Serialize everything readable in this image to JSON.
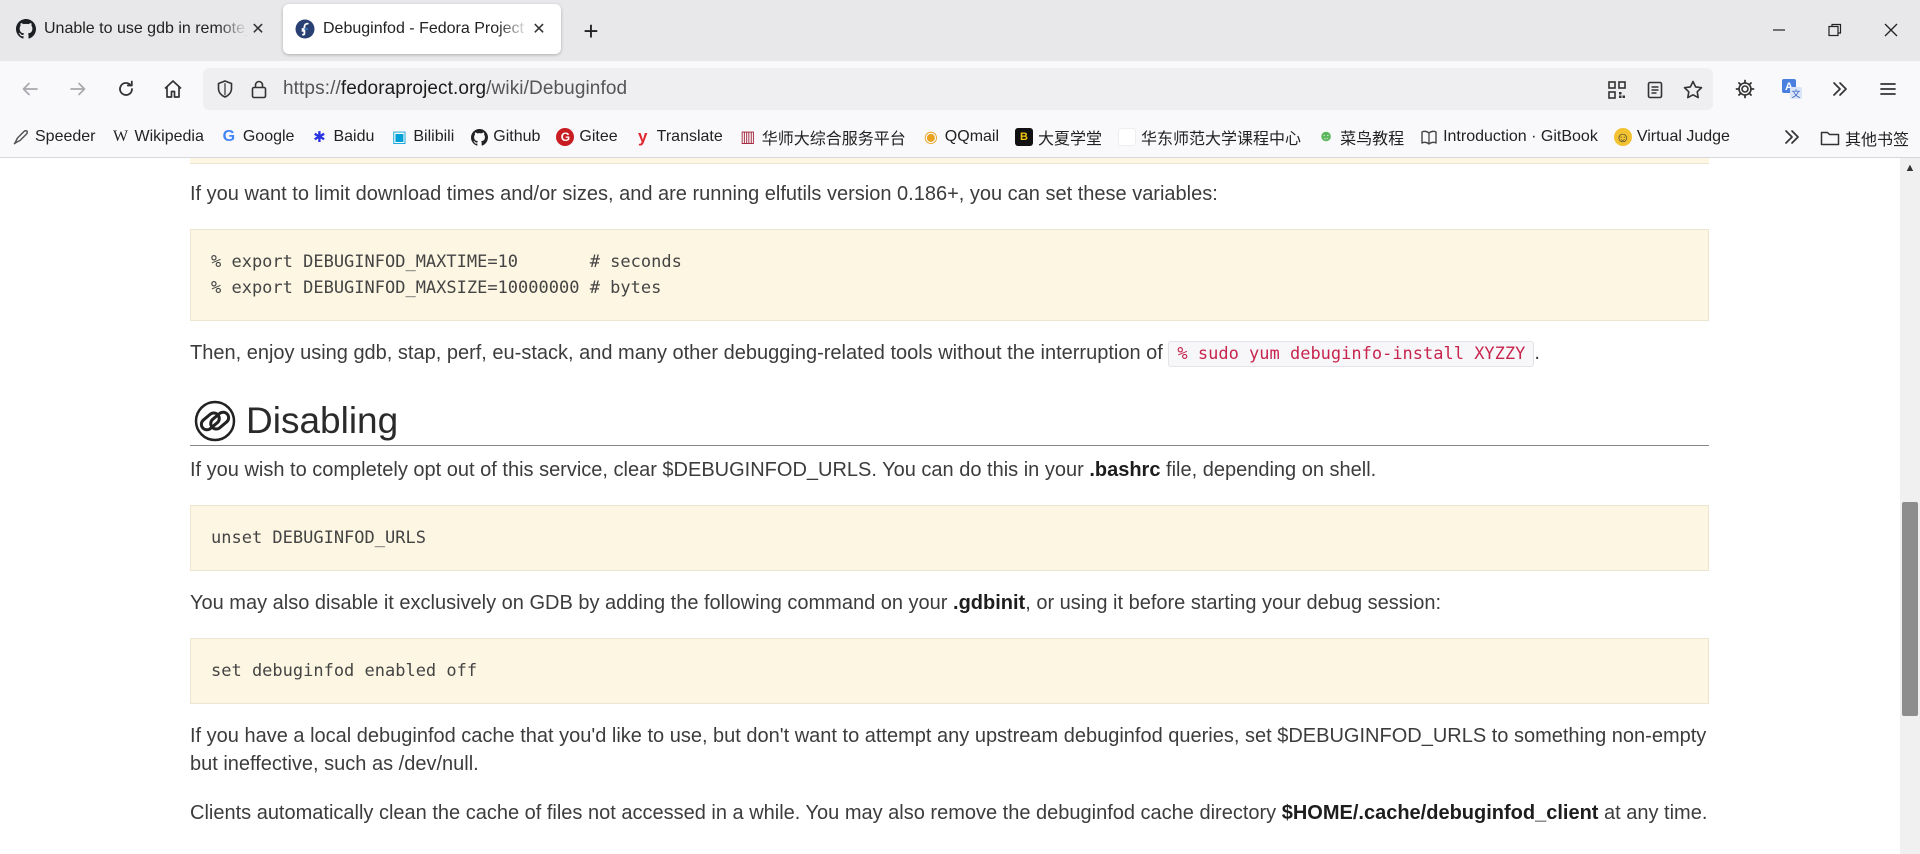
{
  "tabs": [
    {
      "title": "Unable to use gdb in remote_",
      "favicon": "github-icon",
      "active": false
    },
    {
      "title": "Debuginfod - Fedora Project",
      "favicon": "fedora-icon",
      "active": true
    }
  ],
  "toolbar": {
    "url_prefix": "https://",
    "url_host": "fedoraproject.org",
    "url_path": "/wiki/Debuginfod"
  },
  "bookmarks": [
    {
      "label": "Speeder",
      "icon": "rocket-icon",
      "color": "#555555"
    },
    {
      "label": "Wikipedia",
      "icon": "wikipedia-icon",
      "color": "#222222",
      "glyph": "W"
    },
    {
      "label": "Google",
      "icon": "google-icon",
      "color": "#4285f4",
      "glyph": "G"
    },
    {
      "label": "Baidu",
      "icon": "baidu-icon",
      "color": "#2932e1",
      "glyph": "✱"
    },
    {
      "label": "Bilibili",
      "icon": "bilibili-icon",
      "color": "#00a1d6",
      "glyph": "▣"
    },
    {
      "label": "Github",
      "icon": "github-icon",
      "color": "#222222",
      "glyph": "●"
    },
    {
      "label": "Gitee",
      "icon": "gitee-icon",
      "color": "#c71d23",
      "glyph": "G"
    },
    {
      "label": "Translate",
      "icon": "youdao-icon",
      "color": "#e0262f",
      "glyph": "y"
    },
    {
      "label": "华师大综合服务平台",
      "icon": "ecnu-icon",
      "color": "#9e1b32",
      "glyph": "▥"
    },
    {
      "label": "QQmail",
      "icon": "qqmail-icon",
      "color": "#e9a21c",
      "glyph": "◉"
    },
    {
      "label": "大夏学堂",
      "icon": "daxia-icon",
      "color": "#111111",
      "glyph": "B"
    },
    {
      "label": "华东师范大学课程中心",
      "icon": "blank-page-icon",
      "color": "#ffffff",
      "glyph": ""
    },
    {
      "label": "菜鸟教程",
      "icon": "runoob-icon",
      "color": "#5db75d",
      "glyph": "☻"
    },
    {
      "label": "Introduction · GitBook",
      "icon": "gitbook-icon",
      "color": "#444444",
      "glyph": "▯"
    },
    {
      "label": "Virtual Judge",
      "icon": "vjudge-icon",
      "color": "#f2c230",
      "glyph": "☺"
    }
  ],
  "bookmarks_folder": "其他书签",
  "content": {
    "p1": "If you want to limit download times and/or sizes, and are running elfutils version 0.186+, you can set these variables:",
    "code1_line1": "% export DEBUGINFOD_MAXTIME=10       # seconds",
    "code1_line2": "% export DEBUGINFOD_MAXSIZE=10000000 # bytes",
    "p2_text": "Then, enjoy using gdb, stap, perf, eu-stack, and many other debugging-related tools without the interruption of",
    "p2_code": "% sudo yum debuginfo-install XYZZY",
    "p2_end": ".",
    "heading": "Disabling",
    "p3_text": "If you wish to completely opt out of this service, clear $DEBUGINFOD_URLS. You can do this in your",
    "p3_bold": ".bashrc",
    "p3_end": "file, depending on shell.",
    "code2": "unset DEBUGINFOD_URLS",
    "p4_text": "You may also disable it exclusively on GDB by adding the following command on your",
    "p4_bold": ".gdbinit",
    "p4_end": ", or using it before starting your debug session:",
    "code3": "set debuginfod enabled off",
    "p5": "If you have a local debuginfod cache that you'd like to use, but don't want to attempt any upstream debuginfod queries, set $DEBUGINFOD_URLS to something non-empty but ineffective, such as /dev/null.",
    "p6_text": "Clients automatically clean the cache of files not accessed in a while. You may also remove the debuginfod cache directory",
    "p6_bold": "$HOME/.cache/debuginfod_client",
    "p6_end": "at any time."
  },
  "colors": {
    "code_bg": "#fcf6e3",
    "inline_code": "#c7254e",
    "accent": "#294172"
  }
}
